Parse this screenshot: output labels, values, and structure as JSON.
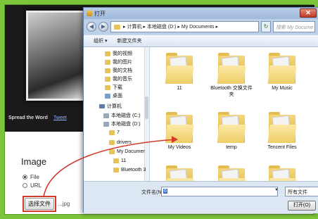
{
  "background": {
    "spread_label": "Spread the Word",
    "spread_link": "Tweet",
    "image_heading": "Image",
    "radio_options": [
      {
        "label": "File",
        "selected": true
      },
      {
        "label": "URL",
        "selected": false
      }
    ],
    "choose_file_button": "选择文件",
    "file_suffix": "...jpg",
    "accent_color": "#d23b2b"
  },
  "dialog": {
    "title": "打开",
    "close_symbol": "✕",
    "back_symbol": "◀",
    "forward_symbol": "▶",
    "address": "▸ 计算机 ▸ 本地磁盘 (D:) ▸ My Documents ▸",
    "refresh_symbol": "↻",
    "search_placeholder": "搜索 My Docume",
    "toolbar": {
      "organize": "组织 ▾",
      "new_folder": "新建文件夹"
    },
    "nav_items": [
      {
        "label": "我的视频",
        "icon": "folder"
      },
      {
        "label": "我的图片",
        "icon": "folder"
      },
      {
        "label": "我的文档",
        "icon": "folder"
      },
      {
        "label": "我的音乐",
        "icon": "folder"
      },
      {
        "label": "下载",
        "icon": "folder"
      },
      {
        "label": "桌面",
        "icon": "desktop"
      },
      {
        "label": "计算机",
        "icon": "computer"
      },
      {
        "label": "本地磁盘 (C:)",
        "icon": "drive"
      },
      {
        "label": "本地磁盘 (D:)",
        "icon": "drive"
      },
      {
        "label": "7",
        "icon": "folder"
      },
      {
        "label": "drivers",
        "icon": "folder"
      },
      {
        "label": "My Documer",
        "icon": "folder"
      },
      {
        "label": "11",
        "icon": "folder"
      },
      {
        "label": "Bluetooth 3",
        "icon": "folder"
      }
    ],
    "files": [
      {
        "label": "11"
      },
      {
        "label": "Bluetooth 交换文件夹"
      },
      {
        "label": "My Music"
      },
      {
        "label": "My Videos"
      },
      {
        "label": "temp"
      },
      {
        "label": "Tencent Files"
      }
    ],
    "filename_label": "文件名(N):",
    "filename_value": "6",
    "filetype_value": "所有文件",
    "open_button": "打开(O)"
  }
}
